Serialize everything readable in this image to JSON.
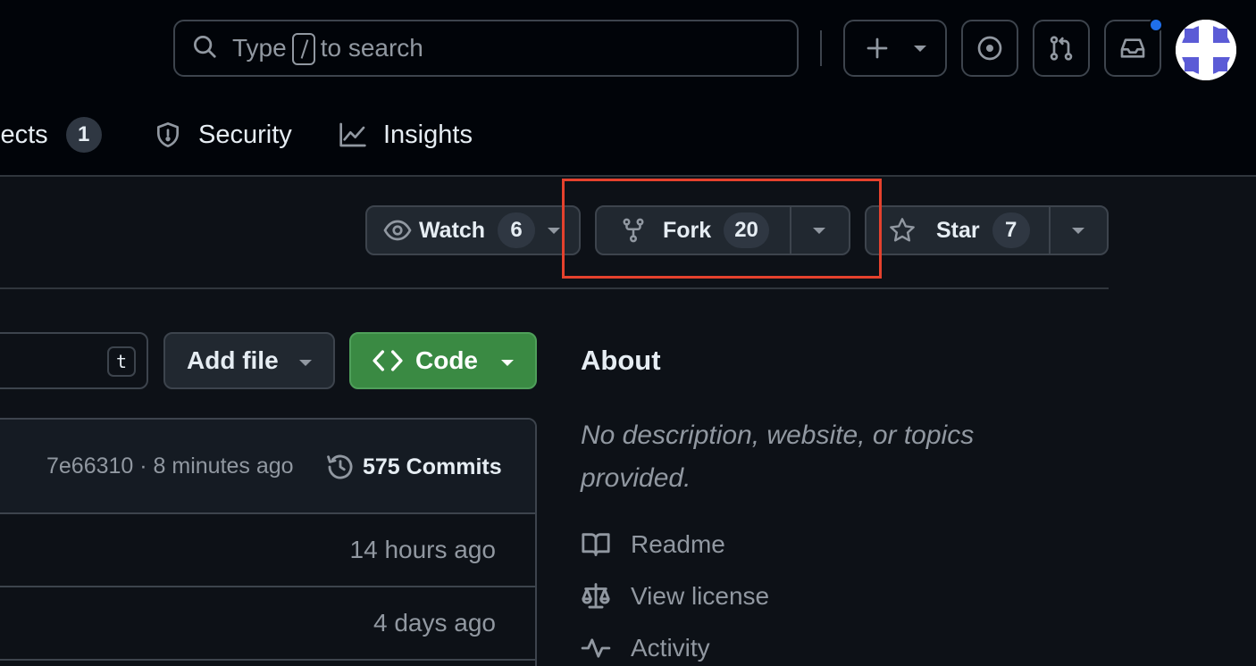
{
  "header": {
    "search": {
      "prefix": "Type",
      "suffix": "to search",
      "icon": "search-icon"
    },
    "create_icon": "plus-icon",
    "issues_icon": "issue-opened-icon",
    "pulls_icon": "git-pull-request-icon",
    "inbox_icon": "inbox-icon",
    "notification_dot_color": "#1f6feb"
  },
  "tabs": [
    {
      "label": "jects",
      "count": "1",
      "icon": "table-icon"
    },
    {
      "label": "Security",
      "icon": "shield-icon"
    },
    {
      "label": "Insights",
      "icon": "graph-icon"
    }
  ],
  "repo_actions": {
    "watch": {
      "label": "Watch",
      "count": "6",
      "icon": "eye-icon"
    },
    "fork": {
      "label": "Fork",
      "count": "20",
      "icon": "repo-forked-icon"
    },
    "star": {
      "label": "Star",
      "count": "7",
      "icon": "star-icon"
    },
    "highlight_color": "#e5412d"
  },
  "toolbar": {
    "file_shortcut": "t",
    "add_file": "Add file",
    "code": "Code",
    "code_color": "#3a8a43"
  },
  "latest_commit": {
    "meta": "7e66310 · 8 minutes ago",
    "commits_label": "575 Commits"
  },
  "files": [
    {
      "time": "14 hours ago"
    },
    {
      "time": "4 days ago"
    }
  ],
  "about": {
    "title": "About",
    "description": "No description, website, or topics provided.",
    "links": [
      {
        "label": "Readme",
        "icon": "book-icon"
      },
      {
        "label": "View license",
        "icon": "law-icon"
      },
      {
        "label": "Activity",
        "icon": "pulse-icon"
      }
    ]
  }
}
